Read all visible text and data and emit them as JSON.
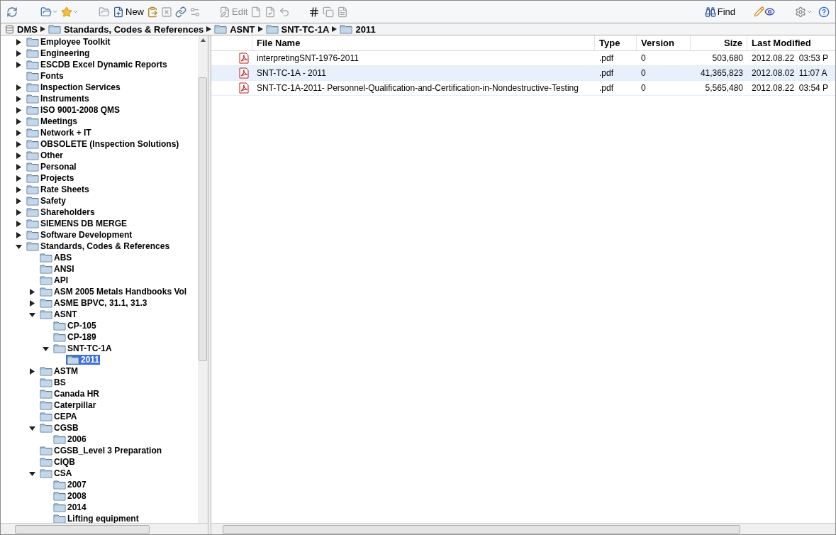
{
  "toolbar": {
    "buttons": [
      {
        "label": "New",
        "disabled": false
      },
      {
        "label": "Edit",
        "disabled": true
      },
      {
        "label": "Find",
        "disabled": false
      }
    ]
  },
  "breadcrumb": [
    {
      "label": "DMS",
      "kind": "root"
    },
    {
      "label": "Standards, Codes & References",
      "kind": "folder"
    },
    {
      "label": "ASNT",
      "kind": "folder"
    },
    {
      "label": "SNT-TC-1A",
      "kind": "folder"
    },
    {
      "label": "2011",
      "kind": "folder"
    }
  ],
  "tree": [
    {
      "label": "Employee Toolkit",
      "expanded": false,
      "selected": false
    },
    {
      "label": "Engineering",
      "expanded": false,
      "selected": false
    },
    {
      "label": "ESCDB Excel Dynamic Reports",
      "expanded": false,
      "selected": false
    },
    {
      "label": "Fonts",
      "selected": false
    },
    {
      "label": "Inspection Services",
      "expanded": false,
      "selected": false
    },
    {
      "label": "Instruments",
      "expanded": false,
      "selected": false
    },
    {
      "label": "ISO 9001-2008 QMS",
      "expanded": false,
      "selected": false
    },
    {
      "label": "Meetings",
      "expanded": false,
      "selected": false
    },
    {
      "label": "Network + IT",
      "expanded": false,
      "selected": false
    },
    {
      "label": "OBSOLETE (Inspection Solutions)",
      "expanded": false,
      "selected": false
    },
    {
      "label": "Other",
      "expanded": false,
      "selected": false
    },
    {
      "label": "Personal",
      "expanded": false,
      "selected": false
    },
    {
      "label": "Projects",
      "expanded": false,
      "selected": false
    },
    {
      "label": "Rate Sheets",
      "expanded": false,
      "selected": false
    },
    {
      "label": "Safety",
      "expanded": false,
      "selected": false
    },
    {
      "label": "Shareholders",
      "expanded": false,
      "selected": false
    },
    {
      "label": "SIEMENS DB MERGE",
      "expanded": false,
      "selected": false
    },
    {
      "label": "Software Development",
      "expanded": false,
      "selected": false
    },
    {
      "label": "Standards, Codes & References",
      "expanded": true,
      "selected": false,
      "children": [
        {
          "label": "ABS",
          "selected": false
        },
        {
          "label": "ANSI",
          "selected": false
        },
        {
          "label": "API",
          "selected": false
        },
        {
          "label": "ASM 2005 Metals Handbooks Vol",
          "expanded": false,
          "selected": false
        },
        {
          "label": "ASME BPVC, 31.1, 31.3",
          "expanded": false,
          "selected": false
        },
        {
          "label": "ASNT",
          "expanded": true,
          "selected": false,
          "children": [
            {
              "label": "CP-105",
              "selected": false
            },
            {
              "label": "CP-189",
              "selected": false
            },
            {
              "label": "SNT-TC-1A",
              "expanded": true,
              "selected": false,
              "children": [
                {
                  "label": "2011",
                  "selected": true
                }
              ]
            }
          ]
        },
        {
          "label": "ASTM",
          "expanded": false,
          "selected": false
        },
        {
          "label": "BS",
          "selected": false
        },
        {
          "label": "Canada HR",
          "selected": false
        },
        {
          "label": "Caterpillar",
          "selected": false
        },
        {
          "label": "CEPA",
          "selected": false
        },
        {
          "label": "CGSB",
          "expanded": true,
          "selected": false,
          "children": [
            {
              "label": "2006",
              "selected": false
            }
          ]
        },
        {
          "label": "CGSB_Level 3 Preparation",
          "selected": false
        },
        {
          "label": "CIQB",
          "selected": false
        },
        {
          "label": "CSA",
          "expanded": true,
          "selected": false,
          "children": [
            {
              "label": "2007",
              "selected": false
            },
            {
              "label": "2008",
              "selected": false
            },
            {
              "label": "2014",
              "selected": false
            },
            {
              "label": "Lifting equipment",
              "selected": false
            }
          ]
        }
      ]
    }
  ],
  "files": {
    "columns": [
      "File Name",
      "Type",
      "Version",
      "Size",
      "Last Modified"
    ],
    "rows": [
      {
        "name": "interpretingSNT-1976-2011",
        "type": ".pdf",
        "version": "0",
        "size": "503,680",
        "modified": "2012.08.22  03:53 P",
        "selected": false
      },
      {
        "name": "SNT-TC-1A - 2011",
        "type": ".pdf",
        "version": "0",
        "size": "41,365,823",
        "modified": "2012.08.02  11:07 A",
        "selected": true
      },
      {
        "name": "SNT-TC-1A-2011- Personnel-Qualification-and-Certification-in-Nondestructive-Testing",
        "type": ".pdf",
        "version": "0",
        "size": "5,565,480",
        "modified": "2012.08.22  03:54 P",
        "selected": false
      }
    ]
  }
}
